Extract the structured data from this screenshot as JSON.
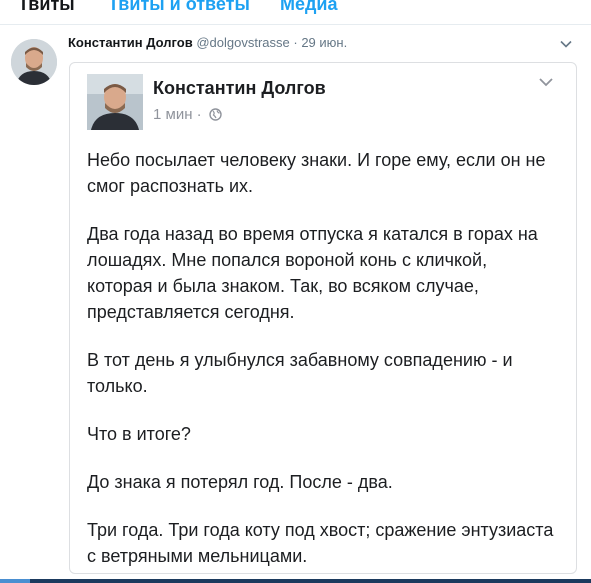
{
  "tabs": [
    {
      "label": "Твиты"
    },
    {
      "label": "Твиты и ответы"
    },
    {
      "label": "Медиа"
    }
  ],
  "tweet": {
    "author_name": "Константин Долгов",
    "handle": "@dolgovstrasse",
    "separator": "·",
    "date": "29 июн."
  },
  "embed": {
    "author_name": "Константин Долгов",
    "time": "1 мин",
    "separator": "·",
    "paragraphs": [
      "Небо посылает человеку знаки. И горе ему, если он не смог распознать их.",
      "Два года назад во время отпуска я катался в горах на лошадях. Мне попался вороной конь с кличкой, которая и была знаком. Так, во всяком случае, представляется сегодня.",
      "В тот день я улыбнулся забавному совпадению - и только.",
      "Что в итоге?",
      "До знака я потерял год. После - два.",
      "Три года. Три года коту под хвост; сражение энтузиаста с ветряными мельницами."
    ]
  },
  "colors": {
    "link_blue": "#1da1f2",
    "muted_gray": "#657786",
    "fb_meta_gray": "#90949c",
    "border": "#dddfe2"
  },
  "icons": {
    "tweet_menu": "chevron-down-icon",
    "embed_menu": "chevron-down-icon",
    "privacy": "globe-icon"
  }
}
